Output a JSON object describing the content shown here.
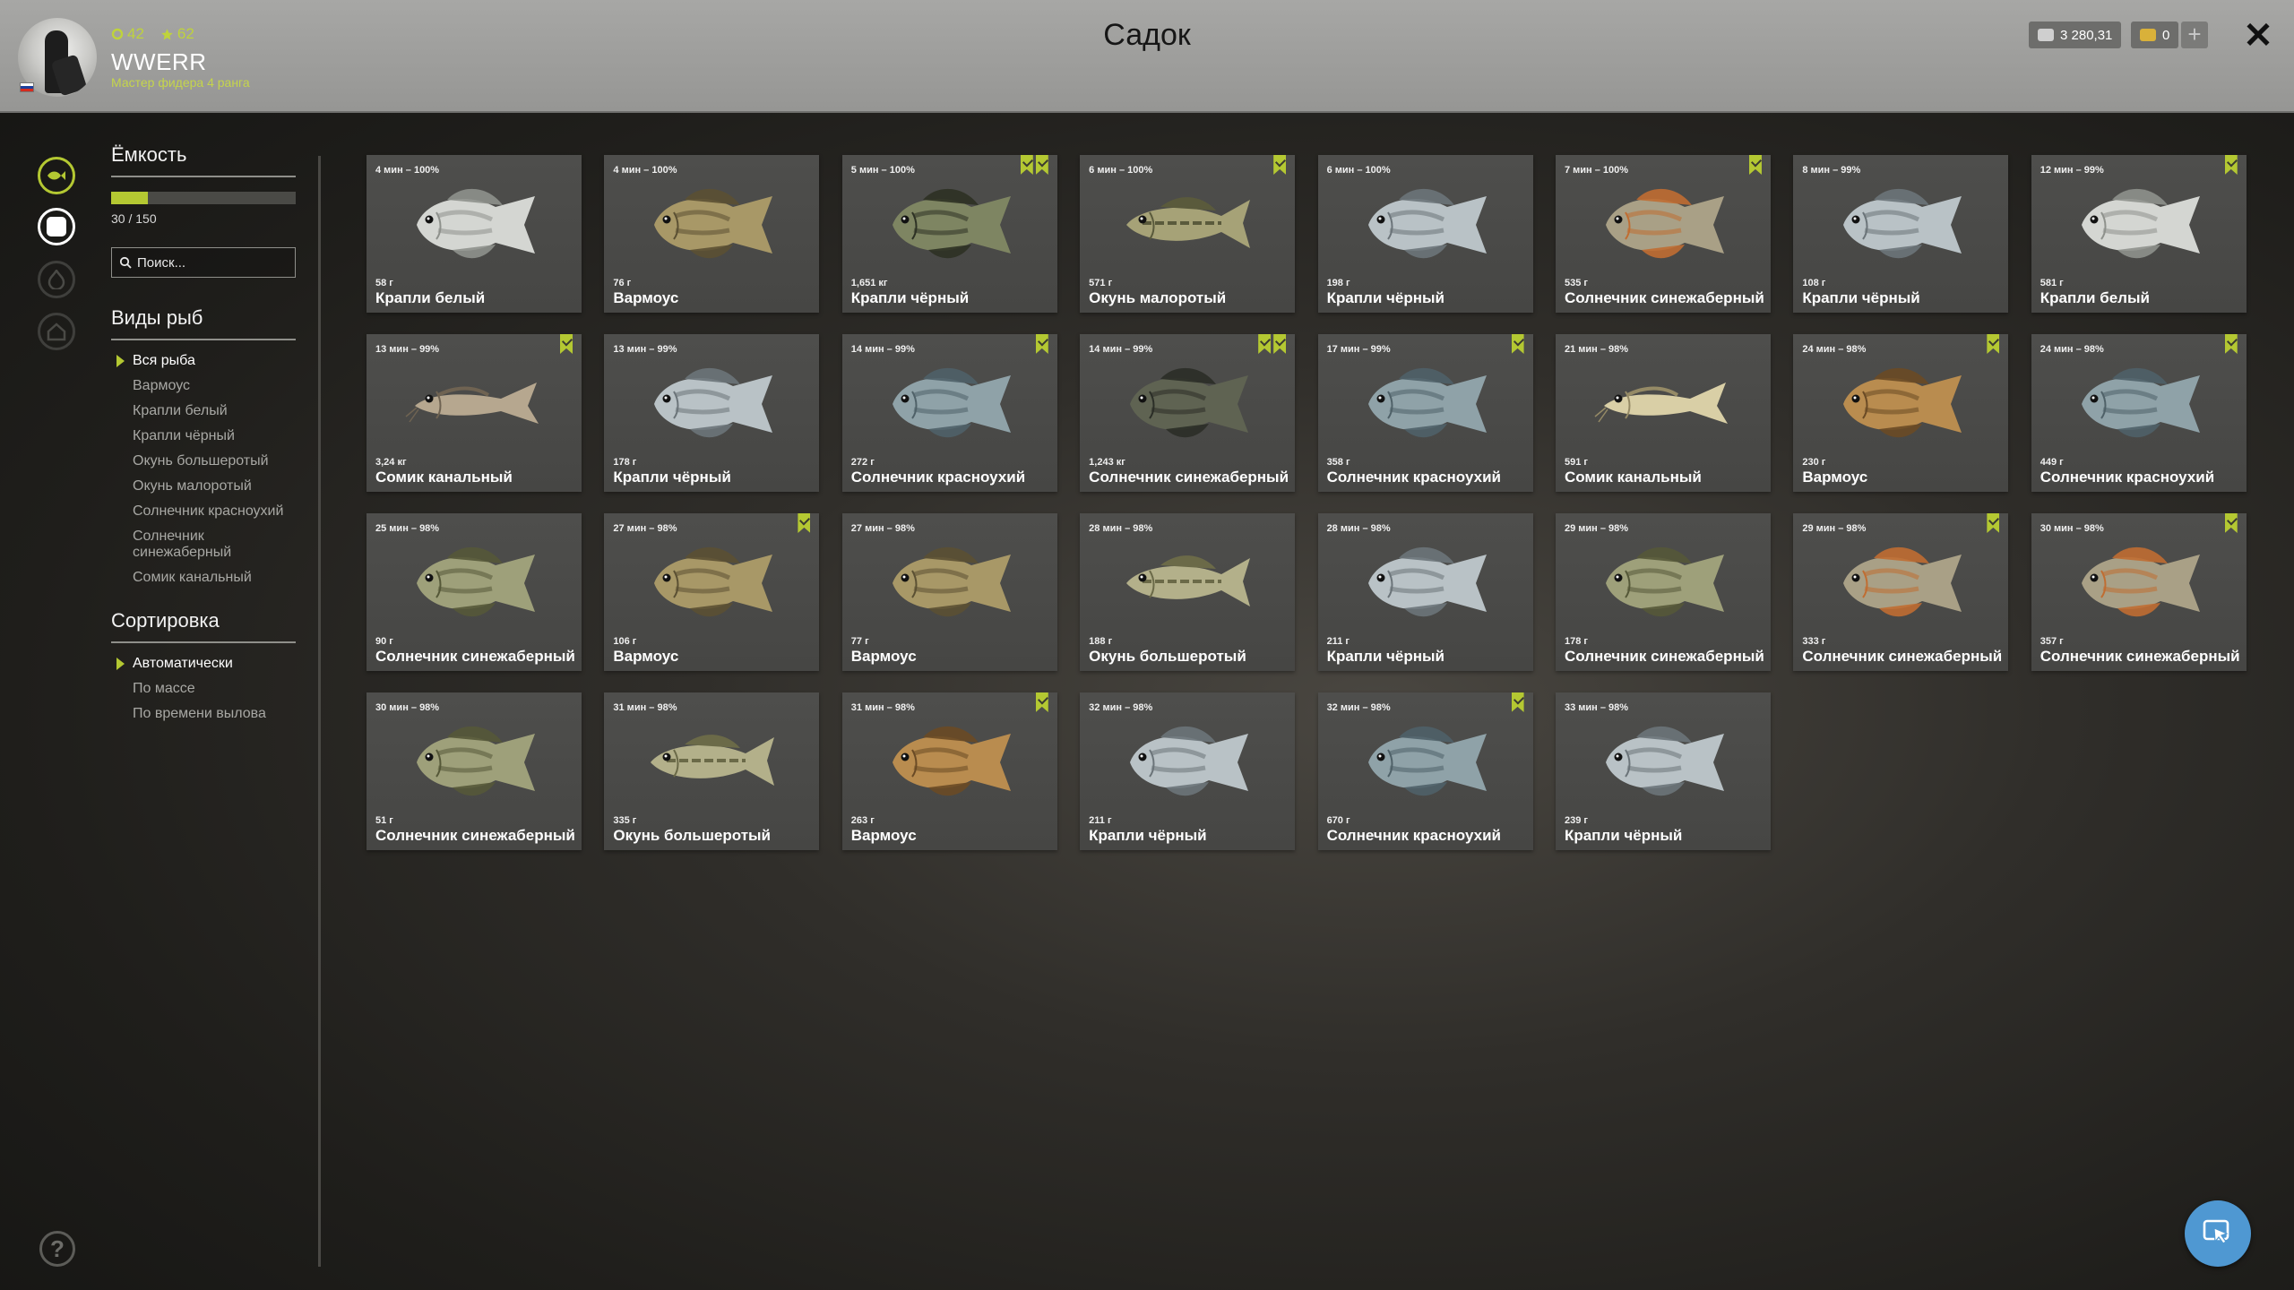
{
  "header": {
    "title": "Садок",
    "player": {
      "name": "WWERR",
      "rank": "Мастер фидера 4 ранга",
      "level": "42",
      "stars": "62"
    },
    "money": "3 280,31",
    "gold": "0",
    "plus_label": "+",
    "close_label": "✕"
  },
  "sidebar": {
    "capacity": {
      "title": "Ёмкость",
      "text": "30 / 150",
      "fraction": 0.2
    },
    "search_placeholder": "Поиск...",
    "species": {
      "title": "Виды рыб",
      "items": [
        "Вся рыба",
        "Вармоус",
        "Крапли белый",
        "Крапли чёрный",
        "Окунь большеротый",
        "Окунь малоротый",
        "Солнечник красноухий",
        "Солнечник синежаберный",
        "Сомик канальный"
      ],
      "selected": 0
    },
    "sort": {
      "title": "Сортировка",
      "items": [
        "Автоматически",
        "По массе",
        "По времени вылова"
      ],
      "selected": 0
    },
    "help_label": "?"
  },
  "fish": [
    {
      "time": "4 мин – 100%",
      "weight": "58 г",
      "name": "Крапли белый",
      "marks": 0,
      "type": "crappie-white"
    },
    {
      "time": "4 мин – 100%",
      "weight": "76 г",
      "name": "Вармоус",
      "marks": 0,
      "type": "warmouth"
    },
    {
      "time": "5 мин – 100%",
      "weight": "1,651 кг",
      "name": "Крапли чёрный",
      "marks": 2,
      "type": "crappie-black-dark"
    },
    {
      "time": "6 мин – 100%",
      "weight": "571 г",
      "name": "Окунь малоротый",
      "marks": 1,
      "type": "bass-small"
    },
    {
      "time": "6 мин – 100%",
      "weight": "198 г",
      "name": "Крапли чёрный",
      "marks": 0,
      "type": "crappie-black"
    },
    {
      "time": "7 мин – 100%",
      "weight": "535 г",
      "name": "Солнечник синежаберный",
      "marks": 1,
      "type": "bluegill-orange"
    },
    {
      "time": "8 мин – 99%",
      "weight": "108 г",
      "name": "Крапли чёрный",
      "marks": 0,
      "type": "crappie-black"
    },
    {
      "time": "12 мин – 99%",
      "weight": "581 г",
      "name": "Крапли белый",
      "marks": 1,
      "type": "crappie-white"
    },
    {
      "time": "13 мин – 99%",
      "weight": "3,24 кг",
      "name": "Сомик канальный",
      "marks": 1,
      "type": "catfish"
    },
    {
      "time": "13 мин – 99%",
      "weight": "178 г",
      "name": "Крапли чёрный",
      "marks": 0,
      "type": "crappie-black"
    },
    {
      "time": "14 мин – 99%",
      "weight": "272 г",
      "name": "Солнечник красноухий",
      "marks": 1,
      "type": "redear"
    },
    {
      "time": "14 мин – 99%",
      "weight": "1,243 кг",
      "name": "Солнечник синежаберный",
      "marks": 2,
      "type": "bluegill-dark"
    },
    {
      "time": "17 мин – 99%",
      "weight": "358 г",
      "name": "Солнечник красноухий",
      "marks": 1,
      "type": "redear"
    },
    {
      "time": "21 мин – 98%",
      "weight": "591 г",
      "name": "Сомик канальный",
      "marks": 0,
      "type": "catfish-light"
    },
    {
      "time": "24 мин – 98%",
      "weight": "230 г",
      "name": "Вармоус",
      "marks": 1,
      "type": "warmouth-orange"
    },
    {
      "time": "24 мин – 98%",
      "weight": "449 г",
      "name": "Солнечник красноухий",
      "marks": 1,
      "type": "redear"
    },
    {
      "time": "25 мин – 98%",
      "weight": "90 г",
      "name": "Солнечник синежаберный",
      "marks": 0,
      "type": "bluegill"
    },
    {
      "time": "27 мин – 98%",
      "weight": "106 г",
      "name": "Вармоус",
      "marks": 1,
      "type": "warmouth"
    },
    {
      "time": "27 мин – 98%",
      "weight": "77 г",
      "name": "Вармоус",
      "marks": 0,
      "type": "warmouth"
    },
    {
      "time": "28 мин – 98%",
      "weight": "188 г",
      "name": "Окунь большеротый",
      "marks": 0,
      "type": "bass-large"
    },
    {
      "time": "28 мин – 98%",
      "weight": "211 г",
      "name": "Крапли чёрный",
      "marks": 0,
      "type": "crappie-black"
    },
    {
      "time": "29 мин – 98%",
      "weight": "178 г",
      "name": "Солнечник синежаберный",
      "marks": 0,
      "type": "bluegill"
    },
    {
      "time": "29 мин – 98%",
      "weight": "333 г",
      "name": "Солнечник синежаберный",
      "marks": 1,
      "type": "bluegill-orange"
    },
    {
      "time": "30 мин – 98%",
      "weight": "357 г",
      "name": "Солнечник синежаберный",
      "marks": 1,
      "type": "bluegill-orange"
    },
    {
      "time": "30 мин – 98%",
      "weight": "51 г",
      "name": "Солнечник синежаберный",
      "marks": 0,
      "type": "bluegill"
    },
    {
      "time": "31 мин – 98%",
      "weight": "335 г",
      "name": "Окунь большеротый",
      "marks": 0,
      "type": "bass-large"
    },
    {
      "time": "31 мин – 98%",
      "weight": "263 г",
      "name": "Вармоус",
      "marks": 1,
      "type": "warmouth-orange"
    },
    {
      "time": "32 мин – 98%",
      "weight": "211 г",
      "name": "Крапли чёрный",
      "marks": 0,
      "type": "crappie-black"
    },
    {
      "time": "32 мин – 98%",
      "weight": "670 г",
      "name": "Солнечник красноухий",
      "marks": 1,
      "type": "redear"
    },
    {
      "time": "33 мин – 98%",
      "weight": "239 г",
      "name": "Крапли чёрный",
      "marks": 0,
      "type": "crappie-black"
    }
  ],
  "colors": {
    "accent": "#b4c832",
    "fish": {
      "crappie-white": [
        "#d4d6d2",
        "#8e918c"
      ],
      "crappie-black": [
        "#b9c2c6",
        "#6b7479"
      ],
      "crappie-black-dark": [
        "#7e8562",
        "#2d3124"
      ],
      "warmouth": [
        "#a89867",
        "#5b5033"
      ],
      "warmouth-orange": [
        "#b98c4f",
        "#6a4a25"
      ],
      "bass-small": [
        "#a6a277",
        "#5a5a3c"
      ],
      "bass-large": [
        "#b3b08a",
        "#6b6a48"
      ],
      "bluegill": [
        "#9ea07a",
        "#555838"
      ],
      "bluegill-orange": [
        "#a9a086",
        "#c06d32"
      ],
      "bluegill-dark": [
        "#5f6352",
        "#2b2e27"
      ],
      "redear": [
        "#8fa2a8",
        "#4f6168"
      ],
      "catfish": [
        "#b6a78f",
        "#6f6352"
      ],
      "catfish-light": [
        "#d9cfa6",
        "#958a66"
      ]
    }
  },
  "icons": {
    "rail": [
      "fish-net-icon",
      "keepnet-icon",
      "campfire-icon",
      "house-icon"
    ]
  }
}
